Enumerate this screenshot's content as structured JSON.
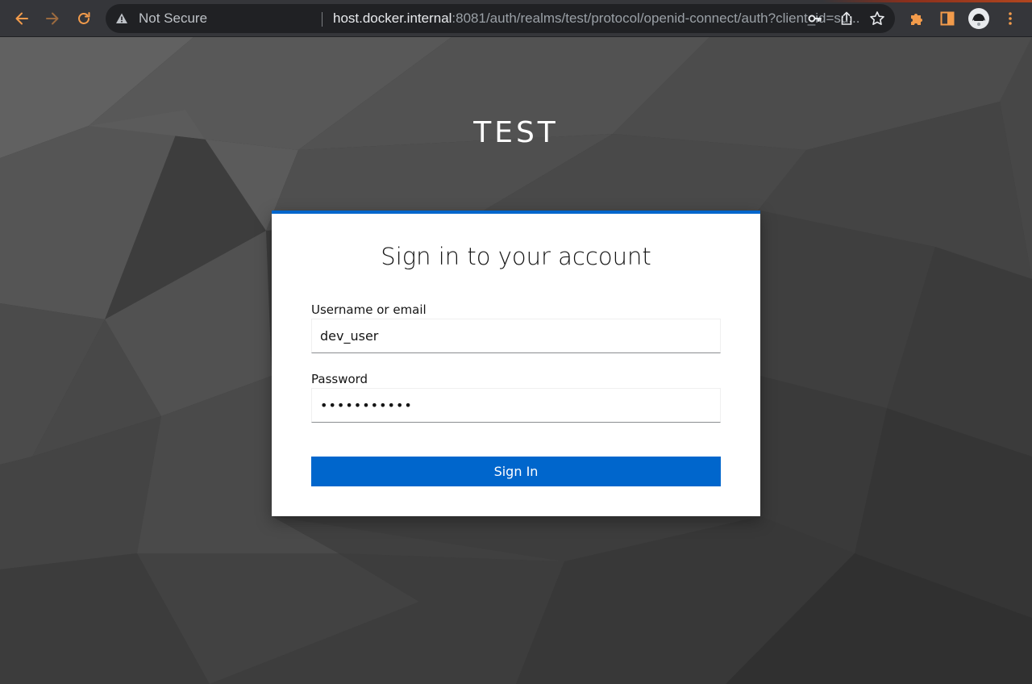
{
  "browser": {
    "security_label": "Not Secure",
    "url_host": "host.docker.internal",
    "url_rest": ":8081/auth/realms/test/protocol/openid-connect/auth?client_id=su..."
  },
  "page": {
    "realm_name": "TEST",
    "heading": "Sign in to your account",
    "username_label": "Username or email",
    "username_value": "dev_user",
    "password_label": "Password",
    "password_value": "devpassword",
    "signin_label": "Sign In"
  },
  "colors": {
    "accent": "#0066cc",
    "browser_icon": "#f29b4b"
  }
}
